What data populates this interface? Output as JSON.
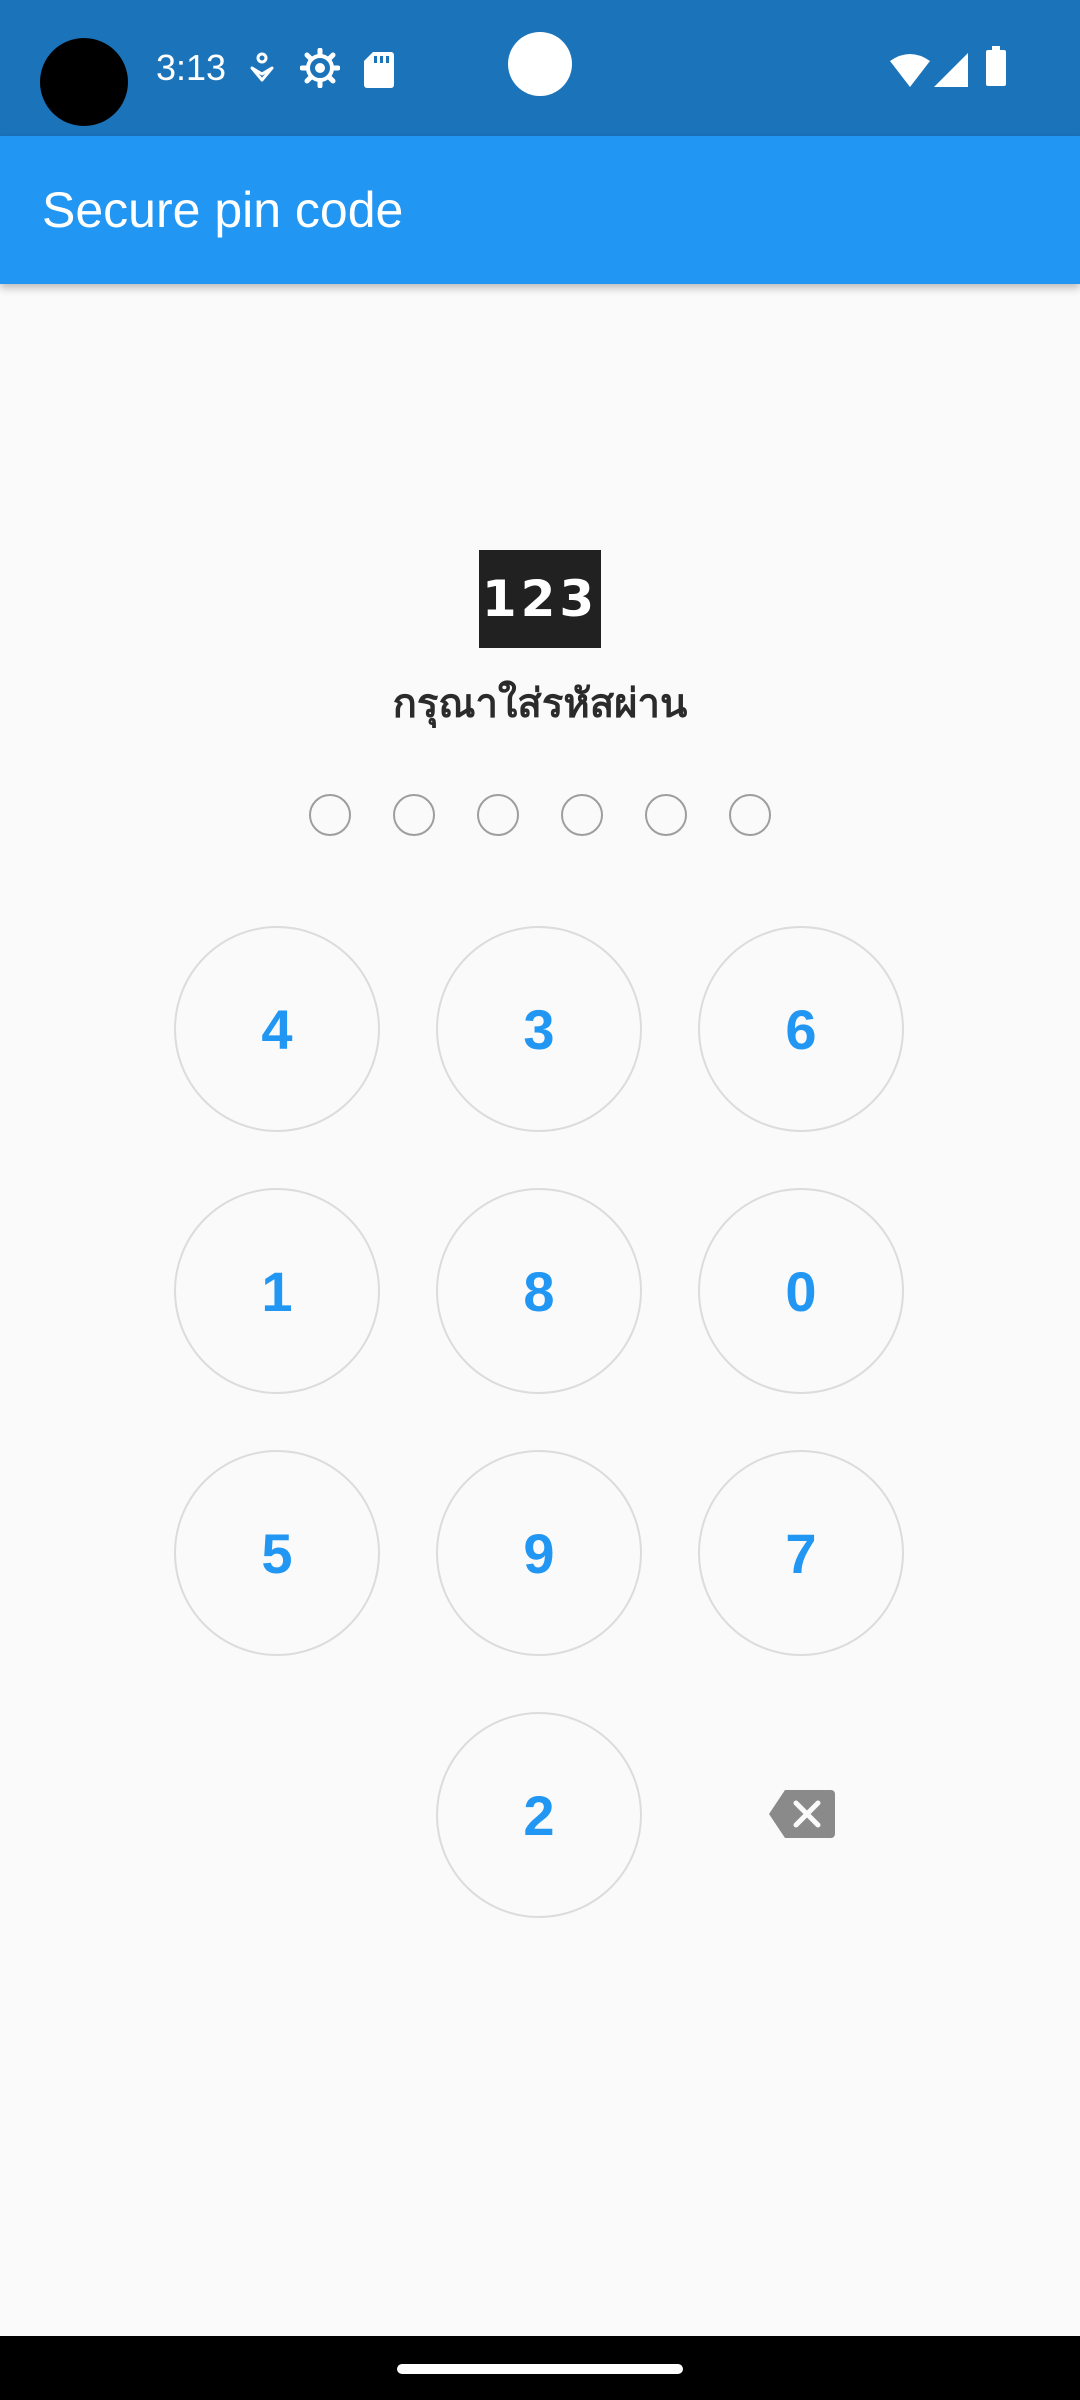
{
  "status_bar": {
    "time": "3:13",
    "icons_left": [
      "accessibility-icon",
      "settings-icon",
      "sd-card-icon"
    ],
    "icons_right": [
      "wifi-icon",
      "cell-signal-icon",
      "battery-icon"
    ]
  },
  "app_bar": {
    "title": "Secure pin code"
  },
  "logo": {
    "text": "123"
  },
  "prompt": "กรุณาใส่รหัสผ่าน",
  "pin": {
    "length": 6,
    "filled": 0
  },
  "keypad": {
    "keys": [
      "4",
      "3",
      "6",
      "1",
      "8",
      "0",
      "5",
      "9",
      "7",
      "2"
    ],
    "backspace_icon": "backspace-icon"
  },
  "colors": {
    "status_bar": "#1b73ba",
    "app_bar": "#2196f3",
    "key_text": "#2196f3",
    "key_border": "#dcdcdc",
    "background": "#fafafa"
  }
}
